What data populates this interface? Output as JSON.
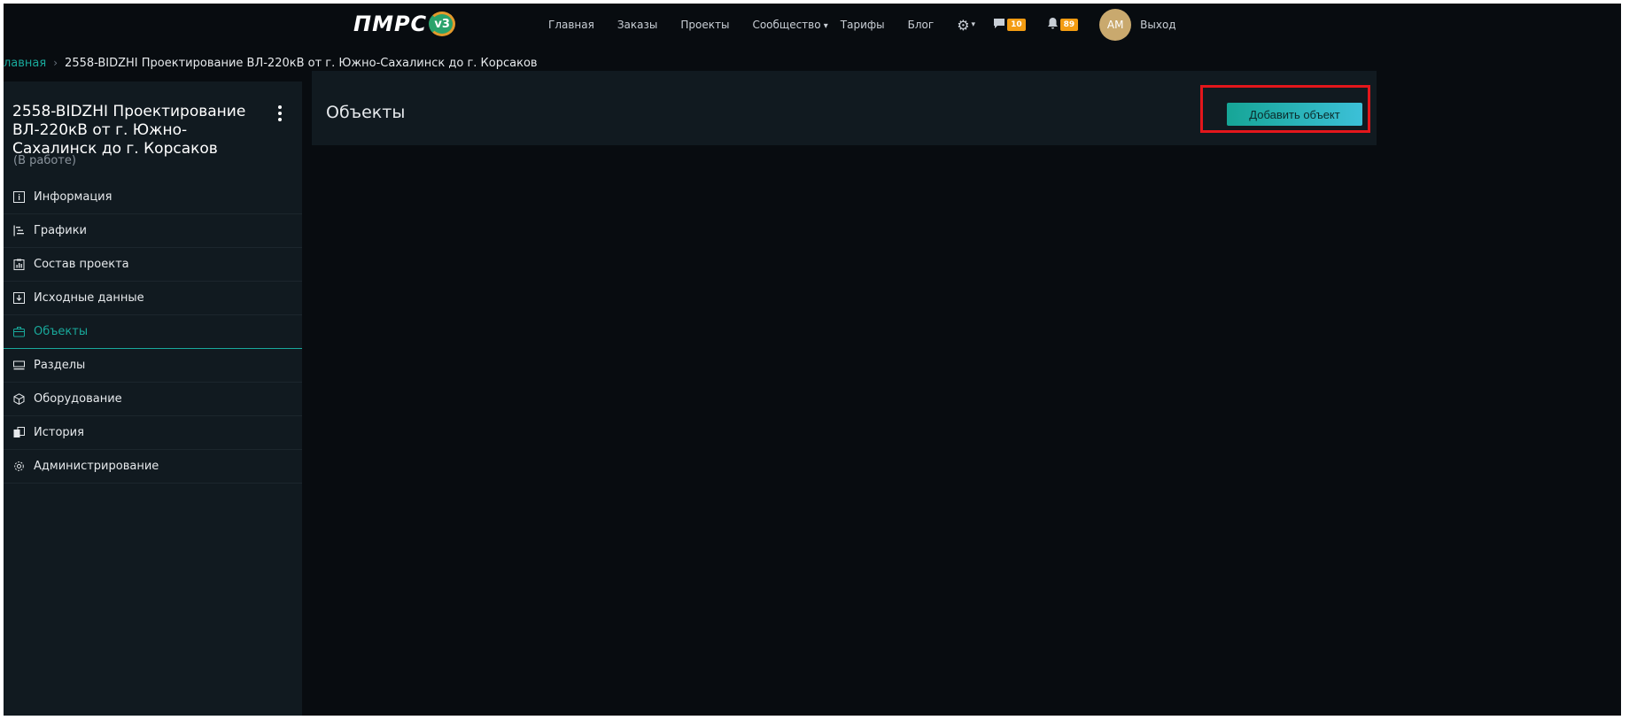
{
  "header": {
    "logo_text": "ПМРС",
    "logo_version": "v3",
    "nav": [
      "Главная",
      "Заказы",
      "Проекты",
      "Сообщество",
      "Тарифы",
      "Блог"
    ],
    "messages_count": "10",
    "notifications_count": "89",
    "avatar_initials": "АМ",
    "logout_label": "Выход"
  },
  "breadcrumb": {
    "home": "лавная",
    "separator": "›",
    "current": "2558-BIDZHI Проектирование ВЛ-220кВ от г. Южно-Сахалинск до г. Корсаков"
  },
  "sidebar": {
    "project_title": "2558-BIDZHI Проектирование ВЛ-220кВ от г. Южно-Сахалинск до г. Корсаков",
    "project_status": "(В работе)",
    "items": [
      {
        "label": "Информация",
        "icon": "info-icon"
      },
      {
        "label": "Графики",
        "icon": "gantt-icon"
      },
      {
        "label": "Состав проекта",
        "icon": "clipboard-chart-icon"
      },
      {
        "label": "Исходные данные",
        "icon": "download-box-icon"
      },
      {
        "label": "Объекты",
        "icon": "briefcase-icon"
      },
      {
        "label": "Разделы",
        "icon": "layers-icon"
      },
      {
        "label": "Оборудование",
        "icon": "cube-icon"
      },
      {
        "label": "История",
        "icon": "history-icon"
      },
      {
        "label": "Администрирование",
        "icon": "gear-icon"
      }
    ]
  },
  "main": {
    "title": "Объекты",
    "add_button_label": "Добавить объект"
  },
  "colors": {
    "accent": "#19a99b",
    "badge": "#f39c12",
    "highlight": "#e3161b"
  }
}
